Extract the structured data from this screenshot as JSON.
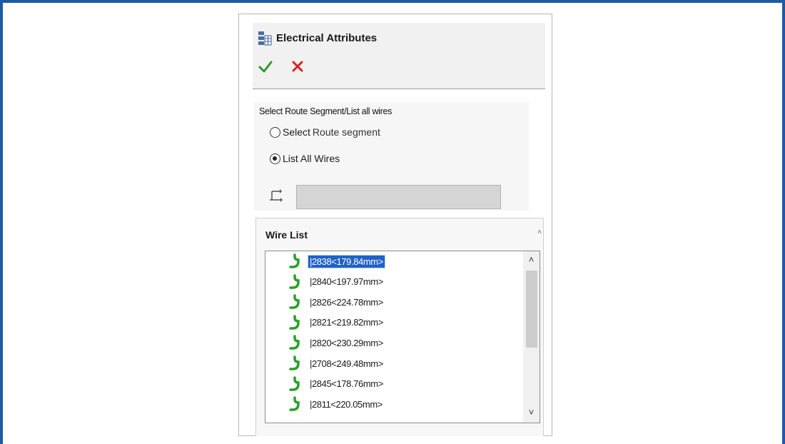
{
  "panel": {
    "title": "Electrical Attributes",
    "title_icon": "electrical-attributes-icon",
    "ok_icon": "checkmark-icon",
    "cancel_icon": "close-icon"
  },
  "selection_group": {
    "title": "Select Route Segment/List all wires",
    "options": [
      {
        "label_part1": "Select",
        "label_part2": "Route segment",
        "checked": false
      },
      {
        "label_part1": "List All Wires",
        "label_part2": "",
        "checked": true
      }
    ],
    "selector_icon": "route-segment-icon",
    "selector_value": ""
  },
  "wire_list": {
    "title": "Wire List",
    "items": [
      "|2838<179.84mm>",
      "|2840<197.97mm>",
      "|2826<224.78mm>",
      "|2821<219.82mm>",
      "|2820<230.29mm>",
      "|2708<249.48mm>",
      "|2845<178.76mm>",
      "|2811<220.05mm>"
    ],
    "selected_index": 0,
    "item_icon": "wire-icon"
  },
  "colors": {
    "frame": "#1e5aa3",
    "ok": "#2e9a2e",
    "cancel": "#e02020",
    "selection": "#1f62c7",
    "wire_icon": "#2aa02a"
  }
}
